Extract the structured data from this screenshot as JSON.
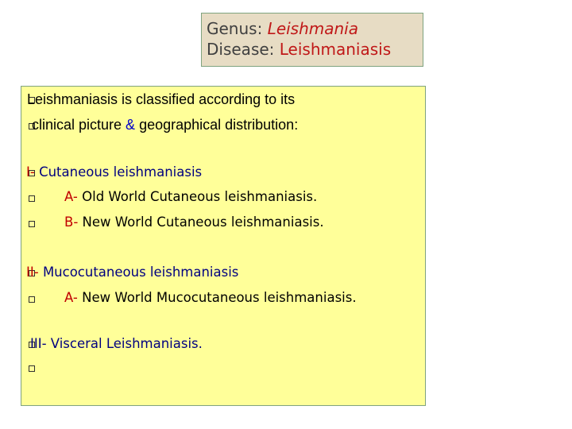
{
  "title": {
    "genus_label": "Genus: ",
    "genus_value": "Leishmania",
    "disease_label": "Disease: ",
    "disease_value": "Leishmaniasis"
  },
  "body": {
    "intro_line1": "Leishmaniasis is classified according to its",
    "intro_line2_a": "clinical picture ",
    "intro_line2_amp": "&",
    "intro_line2_b": " geographical distribution:",
    "cutaneous_num": "I- ",
    "cutaneous_text": "Cutaneous leishmaniasis",
    "old_world_num": "A- ",
    "old_world_text": "Old World Cutaneous leishmaniasis.",
    "new_world_num": "B- ",
    "new_world_text": "New World Cutaneous leishmaniasis.",
    "muco_num": "II- ",
    "muco_text": "Mucocutaneous leishmaniasis",
    "muco_a_num": "A- ",
    "muco_a_text": "New World Mucocutaneous leishmaniasis.",
    "visceral": "III- Visceral Leishmaniasis."
  },
  "colors": {
    "title_bg": "#e7dcc4",
    "content_bg": "#ffff99",
    "accent_red": "#c01818",
    "accent_blue": "#0000c8",
    "accent_navy": "#000080"
  }
}
